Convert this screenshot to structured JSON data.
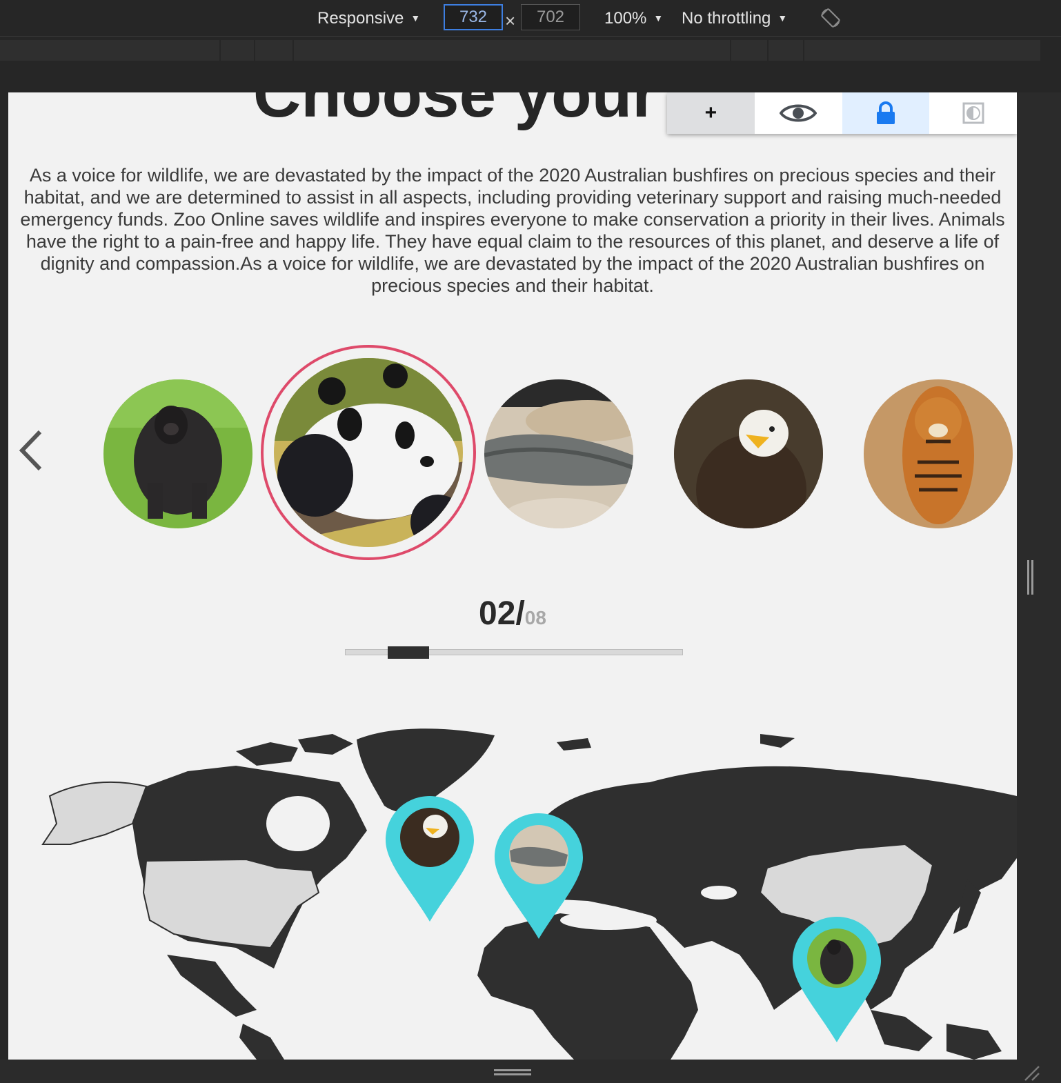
{
  "devtools": {
    "device": "Responsive",
    "width": "732",
    "times": "×",
    "height": "702",
    "zoom": "100%",
    "throttling": "No throttling"
  },
  "toolbar": {
    "add_label": "+"
  },
  "page": {
    "title": "Choose your fav",
    "intro": "As a voice for wildlife, we are devastated by the impact of the 2020 Australian bushfires on precious species and their habitat, and we are determined to assist in all aspects, including providing veterinary support and raising much-needed emergency funds. Zoo Online saves wildlife and inspires everyone to make conservation a priority in their lives. Animals have the right to a pain-free and happy life. They have equal claim to the resources of this planet, and deserve a life of dignity and compassion.As a voice for wildlife, we are devastated by the impact of the 2020 Australian bushfires on precious species and their habitat."
  },
  "carousel": {
    "animals": [
      "gorilla",
      "panda",
      "alligator",
      "eagle",
      "tiger"
    ],
    "selected": "panda",
    "current": "02/",
    "total": "08",
    "progress": 0.125,
    "accent": "#de4a6a"
  },
  "map": {
    "land_color": "#2f2f2f",
    "highlight_color": "#d9d9d9",
    "pin_color": "#45d2dc",
    "pins": [
      "eagle",
      "alligator",
      "gorilla"
    ]
  }
}
